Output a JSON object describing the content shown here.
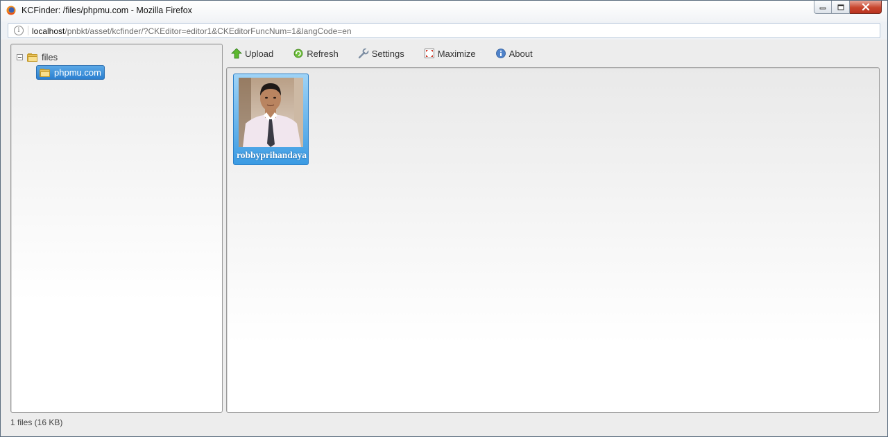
{
  "window": {
    "title": "KCFinder: /files/phpmu.com - Mozilla Firefox"
  },
  "urlbar": {
    "host": "localhost",
    "path": "/pnbkt/asset/kcfinder/?CKEditor=editor1&CKEditorFuncNum=1&langCode=en"
  },
  "tree": {
    "root": {
      "label": "files"
    },
    "child": {
      "label": "phpmu.com"
    }
  },
  "toolbar": {
    "upload": "Upload",
    "refresh": "Refresh",
    "settings": "Settings",
    "maximize": "Maximize",
    "about": "About"
  },
  "files": [
    {
      "name": "robbyprihandaya"
    }
  ],
  "status": {
    "text": "1 files (16 KB)"
  },
  "colors": {
    "selection": "#2a7fd0",
    "close_button": "#c8462e"
  },
  "icons": {
    "browser": "firefox-icon",
    "info": "info-icon",
    "folder": "folder-icon",
    "upload": "upload-arrow-icon",
    "refresh": "refresh-icon",
    "settings": "wrench-icon",
    "maximize": "maximize-icon",
    "about": "about-info-icon"
  }
}
